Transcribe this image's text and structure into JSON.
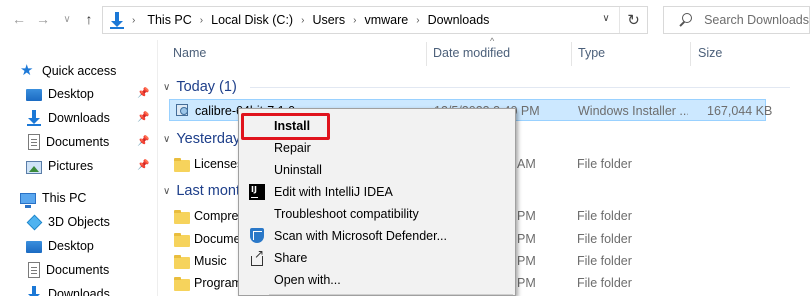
{
  "nav": {
    "back_glyph": "←",
    "forward_glyph": "→",
    "recent_glyph": "∨",
    "up_glyph": "↑",
    "icons": [
      "back-arrow-icon",
      "forward-arrow-icon",
      "chevron-down-icon",
      "up-arrow-icon",
      "downloads-icon",
      "refresh-icon",
      "search-icon"
    ]
  },
  "address": {
    "crumbs": [
      "This PC",
      "Local Disk (C:)",
      "Users",
      "vmware",
      "Downloads"
    ],
    "separator": "›",
    "dropdown_glyph": "∨",
    "refresh_glyph": "↻"
  },
  "search": {
    "placeholder": "Search Downloads"
  },
  "sidebar": {
    "quick_access": "Quick access",
    "pin_glyph": "📌",
    "pinned": [
      {
        "label": "Desktop",
        "icon": "desktop-icon"
      },
      {
        "label": "Downloads",
        "icon": "downloads-icon"
      },
      {
        "label": "Documents",
        "icon": "documents-icon"
      },
      {
        "label": "Pictures",
        "icon": "pictures-icon"
      }
    ],
    "this_pc": "This PC",
    "pc_items": [
      {
        "label": "3D Objects",
        "icon": "3d-objects-icon"
      },
      {
        "label": "Desktop",
        "icon": "desktop-icon"
      },
      {
        "label": "Documents",
        "icon": "documents-icon"
      },
      {
        "label": "Downloads",
        "icon": "downloads-icon"
      }
    ]
  },
  "columns": {
    "name": "Name",
    "date": "Date modified",
    "type": "Type",
    "size": "Size",
    "sort_glyph": "^"
  },
  "groups": {
    "chevron": "∨",
    "today": "Today (1)",
    "yesterday": "Yesterday",
    "last_month": "Last month"
  },
  "rows": {
    "selected": {
      "name": "calibre-64bit-7.1.0",
      "date": "12/5/2023 3:40 PM",
      "type": "Windows Installer ...",
      "size": "167,044 KB"
    },
    "yesterday": [
      {
        "name": "Licenses",
        "date": "AM",
        "type": "File folder"
      }
    ],
    "last_month": [
      {
        "name": "Compres",
        "date": "PM",
        "type": "File folder"
      },
      {
        "name": "Docume",
        "date": "PM",
        "type": "File folder"
      },
      {
        "name": "Music",
        "date": "PM",
        "type": "File folder"
      },
      {
        "name": "Program",
        "date": "PM",
        "type": "File folder"
      }
    ]
  },
  "context_menu": {
    "install": "Install",
    "repair": "Repair",
    "uninstall": "Uninstall",
    "intellij": "Edit with IntelliJ IDEA",
    "troubleshoot": "Troubleshoot compatibility",
    "defender": "Scan with Microsoft Defender...",
    "share": "Share",
    "open_with": "Open with...",
    "highlight_color": "#e0131d"
  },
  "colors": {
    "group_header": "#1e3f8a",
    "selection": "#cce8ff",
    "accent": "#1b78d6",
    "folder": "#f6d35c"
  }
}
